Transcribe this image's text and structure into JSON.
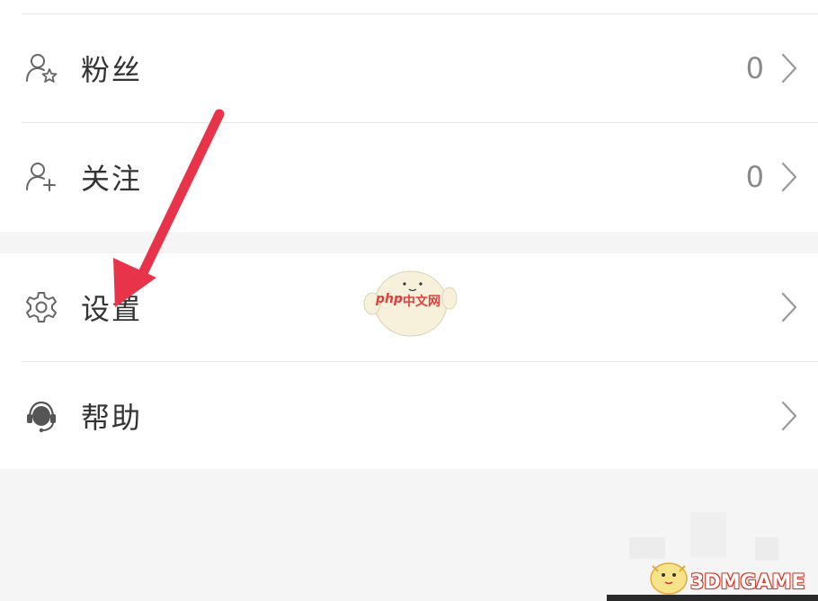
{
  "menu": {
    "fans": {
      "label": "粉丝",
      "count": "0",
      "icon": "fans-person-star-icon"
    },
    "following": {
      "label": "关注",
      "count": "0",
      "icon": "person-add-icon"
    },
    "settings": {
      "label": "设置",
      "icon": "gear-icon"
    },
    "help": {
      "label": "帮助",
      "icon": "headset-icon"
    }
  },
  "annotation": {
    "color": "#e8344a",
    "icon": "arrow-pointing-settings-icon"
  },
  "watermarks": {
    "php": {
      "latin": "php",
      "cn": "中文网"
    },
    "game": {
      "text": "3DMGAME"
    }
  }
}
